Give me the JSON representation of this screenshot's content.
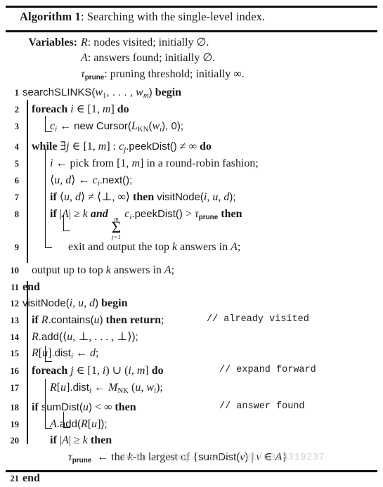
{
  "caption": {
    "label": "Algorithm 1",
    "separator": ": ",
    "title": "Searching with the single-level index."
  },
  "variables": {
    "label": "Variables",
    "colon": ":",
    "rows": [
      {
        "name": "R",
        "text": ": nodes visited; initially ∅."
      },
      {
        "name": "A",
        "text": ": answers found; initially ∅."
      },
      {
        "name": "τ",
        "subscript": "prune",
        "text": ": pruning threshold; initially ∞."
      }
    ]
  },
  "lines": [
    {
      "num": "1",
      "indent": 0,
      "text": "searchSLINKS(w1, . . . , wm) begin"
    },
    {
      "num": "2",
      "indent": 1,
      "text": "foreach i ∈ [1, m] do"
    },
    {
      "num": "3",
      "indent": 2,
      "text": "ci ← new Cursor(LKN(wi), 0);"
    },
    {
      "num": "4",
      "indent": 1,
      "text": "while ∃j ∈ [1, m] : cj.peekDist() ≠ ∞ do"
    },
    {
      "num": "5",
      "indent": 2,
      "text": "i ← pick from [1, m] in a round-robin fashion;"
    },
    {
      "num": "6",
      "indent": 2,
      "text": "⟨u, d⟩ ← ci.next();"
    },
    {
      "num": "7",
      "indent": 2,
      "text": "if ⟨u, d⟩ ≠ ⟨⊥, ∞⟩ then visitNode(i, u, d);"
    },
    {
      "num": "8",
      "indent": 2,
      "text": "if |A| ≥ k and ∑ j=1..m ci.peekDist() > τprune then"
    },
    {
      "num": "9",
      "indent": 3,
      "text": "exit and output the top k answers in A;"
    },
    {
      "num": "10",
      "indent": 1,
      "text": "output up to top k answers in A;"
    },
    {
      "num": "11",
      "indent": 0,
      "text": "end"
    },
    {
      "num": "12",
      "indent": 0,
      "text": "visitNode(i, u, d) begin"
    },
    {
      "num": "13",
      "indent": 1,
      "text": "if R.contains(u) then return;",
      "comment": "// already visited"
    },
    {
      "num": "14",
      "indent": 1,
      "text": "R.add(⟨u, ⊥, . . . , ⊥⟩);"
    },
    {
      "num": "15",
      "indent": 1,
      "text": "R[u].disti ← d;"
    },
    {
      "num": "16",
      "indent": 1,
      "text": "foreach j ∈ [1, i) ∪ (i, m] do",
      "comment": "// expand forward"
    },
    {
      "num": "17",
      "indent": 2,
      "text": "R[u].disti ← MNK(u, wi);"
    },
    {
      "num": "18",
      "indent": 1,
      "text": "if sumDist(u) < ∞ then",
      "comment": "// answer found"
    },
    {
      "num": "19",
      "indent": 2,
      "text": "A.add(R[u]);"
    },
    {
      "num": "20",
      "indent": 2,
      "text": "if |A| ≥ k then"
    },
    {
      "num": "",
      "indent": 3,
      "text": "τprune ← the k-th largest of {sumDist(v) | v ∈ A}"
    },
    {
      "num": "21",
      "indent": 0,
      "text": "end"
    }
  ],
  "watermark": "http://blog. csdn. net/u013319237",
  "colors": {
    "text": "#1a1a1a",
    "rule": "#111111",
    "watermark": "#cfcfcf"
  }
}
